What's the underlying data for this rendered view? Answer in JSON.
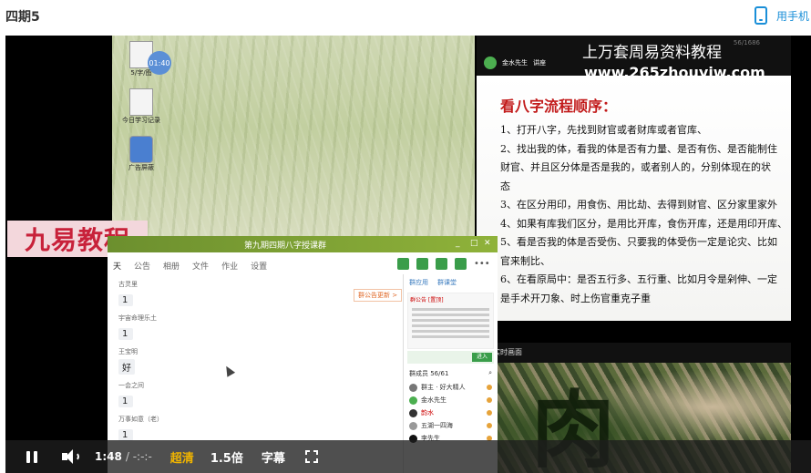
{
  "page": {
    "title": "四期5",
    "mobile_label": "用手机"
  },
  "desktop": {
    "icons": [
      {
        "label": "5/字/图"
      },
      {
        "label": "今日学习记录"
      },
      {
        "label": "广告屏蔽"
      }
    ],
    "clock": "01:40"
  },
  "watermark": {
    "brand": "九易教程",
    "site_title": "上万套周易资料教程",
    "site_url": "www.265zhouyiw.com"
  },
  "chat": {
    "title": "第九期四期八字授课群",
    "tabs": [
      "天",
      "公告",
      "相册",
      "文件",
      "作业",
      "设置"
    ],
    "announce_link": "群公告更新 >",
    "messages": [
      {
        "sender": "古灵里",
        "text": "1"
      },
      {
        "sender": "宇宙命理乐土",
        "text": "1"
      },
      {
        "sender": "王宝明",
        "text": "好"
      },
      {
        "sender": "一会之间",
        "text": "1"
      },
      {
        "sender": "万事如意（老）",
        "text": "1"
      }
    ],
    "side": {
      "tabs": [
        "群应用",
        "群课堂"
      ],
      "notice_head": "群公告 [置顶]",
      "join_label": "进入",
      "member_count": "群成员 56/61",
      "members": [
        {
          "name": "群主 · 好大精人"
        },
        {
          "name": "金水先生"
        },
        {
          "name": "韵水"
        },
        {
          "name": "五湖一四海"
        },
        {
          "name": "李先生"
        }
      ]
    }
  },
  "slide": {
    "presenter": "金水先生",
    "status": "讲座",
    "header_num": "56/1686",
    "title": "看八字流程顺序：",
    "lines": [
      "1、打开八字，先找到财官或者财库或者官库、",
      "2、找出我的体，看我的体是否有力量、是否有伤、是否能制住",
      "财官、并且区分体是否是我的，或者别人的，分别体现在的状",
      "态",
      "3、在区分用印，用食伤、用比劫、去得到财官、区分家里家外",
      "4、如果有库我们区分，是用比开库，食伤开库，还是用印开库、",
      "5、看是否我的体是否受伤、只要我的体受伤一定是论灾、比如",
      "官来制比、",
      "6、在看原局中：是否五行多、五行重、比如月令是剁伸、一定",
      "是手术开刀象、时上伤官重克子重"
    ]
  },
  "camera": {
    "label": "实时画面"
  },
  "player": {
    "current_time": "1:48",
    "duration": "/ -:-:-",
    "quality": "超清",
    "speed": "1.5倍",
    "subtitle": "字幕"
  }
}
